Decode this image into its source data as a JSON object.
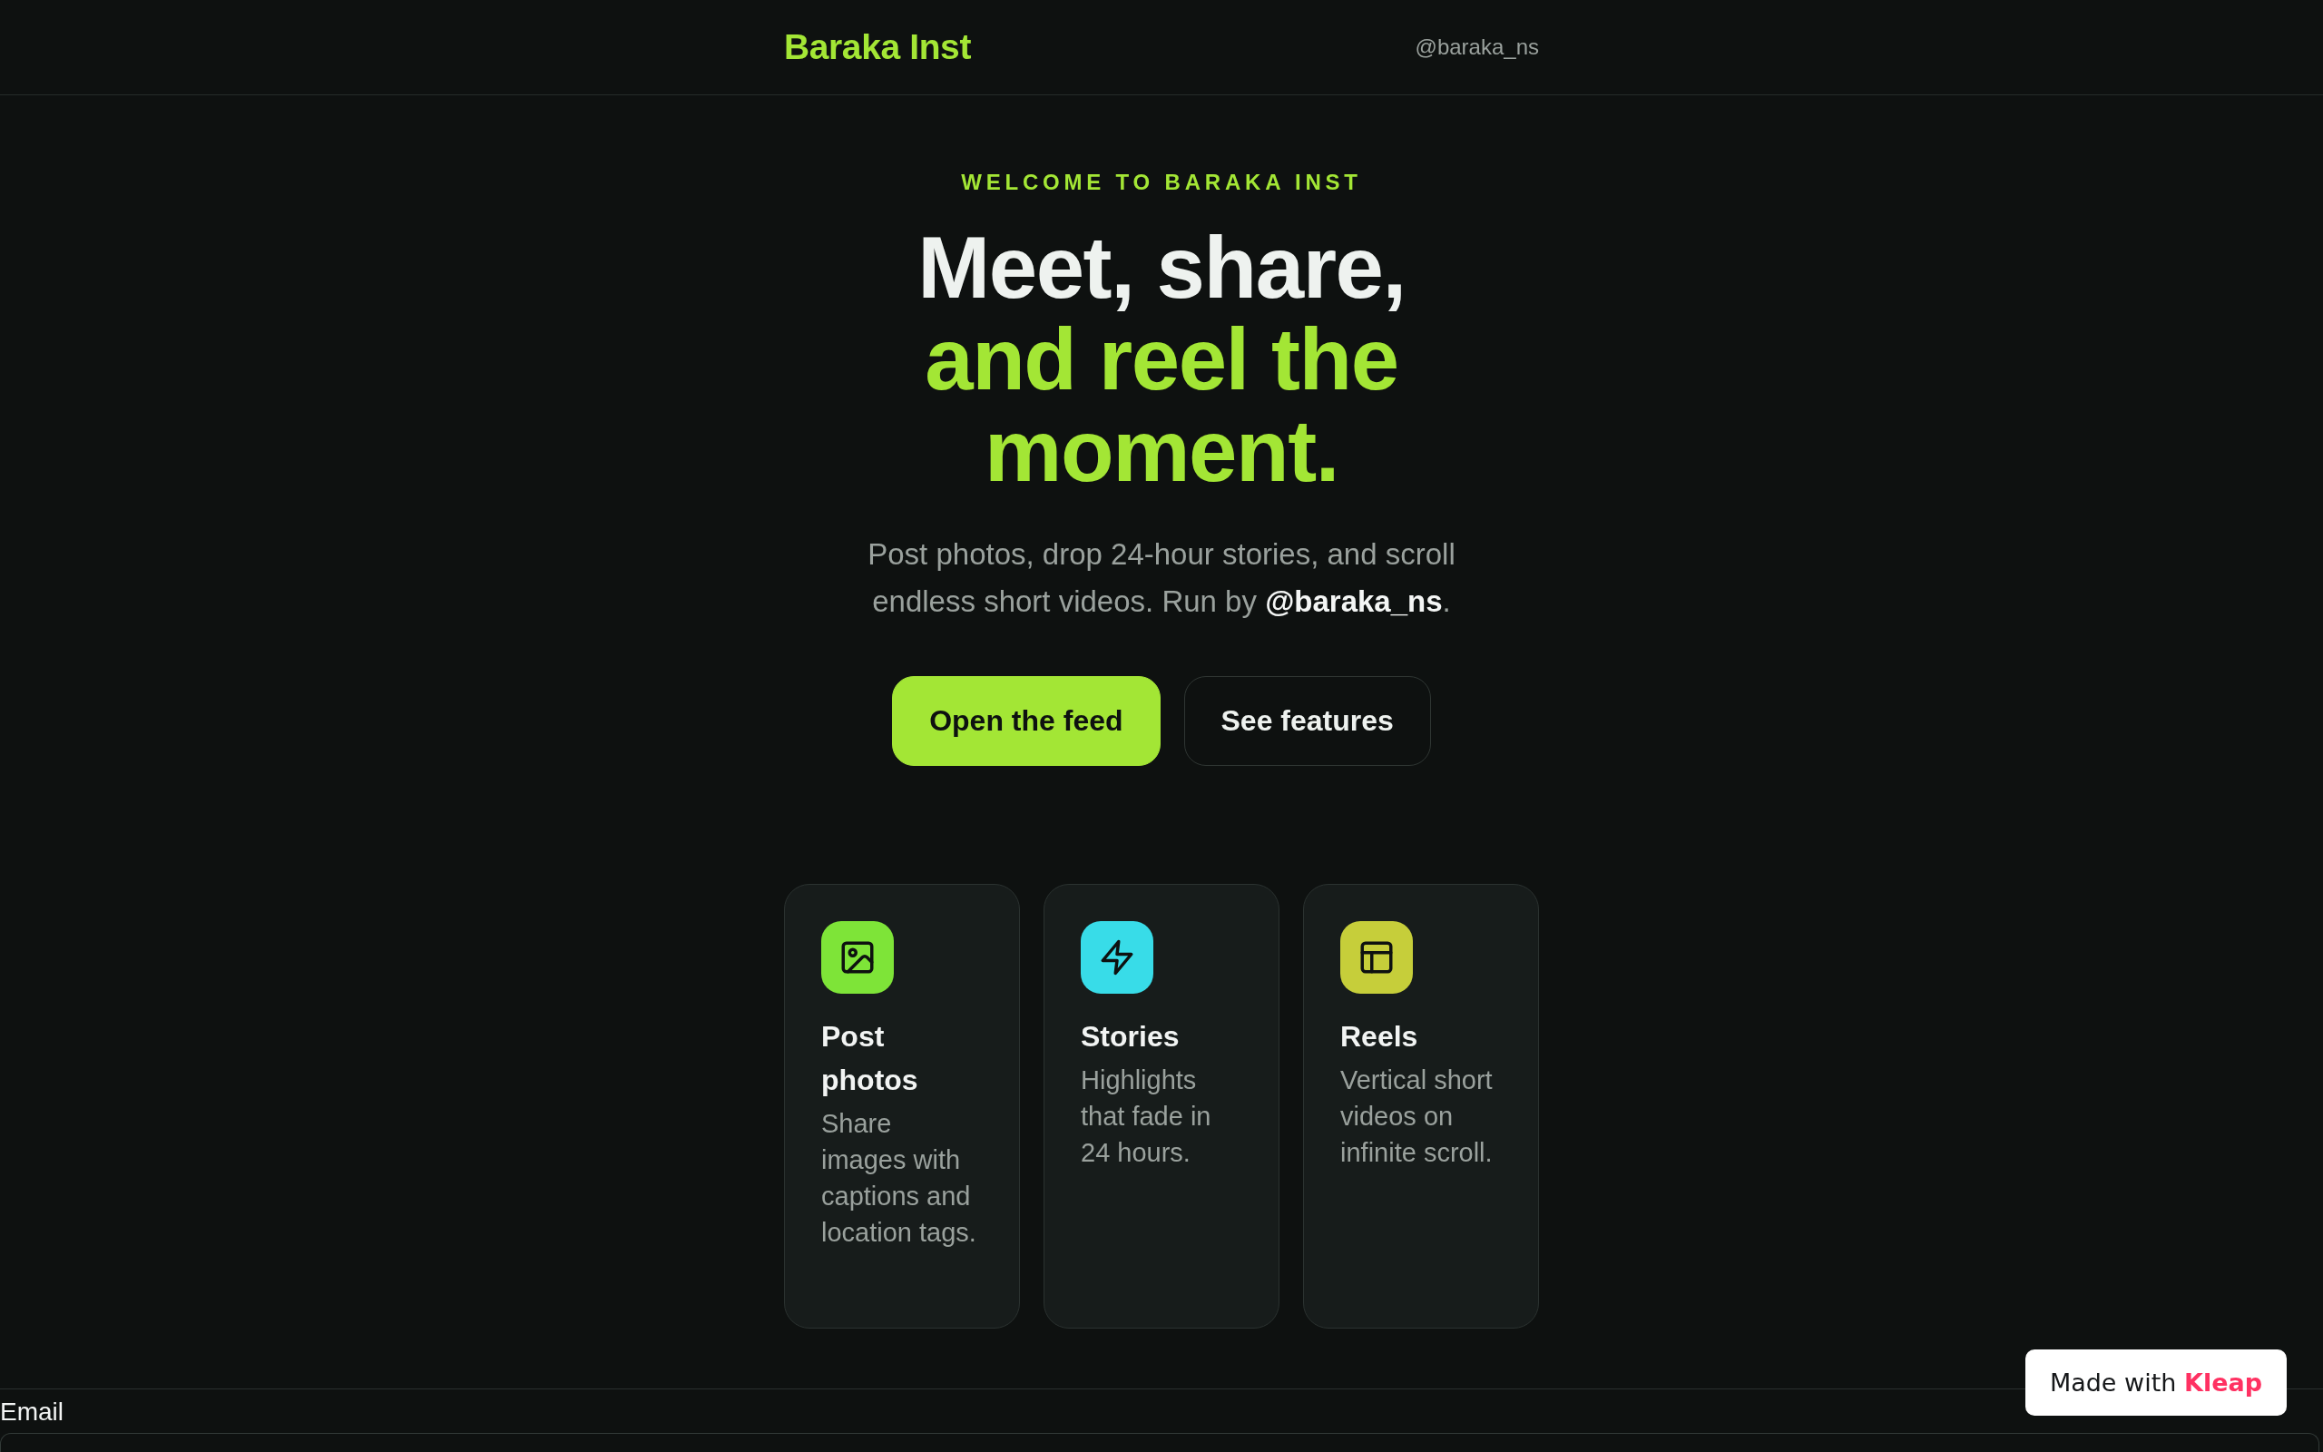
{
  "header": {
    "brand": "Baraka Inst",
    "handle": "@baraka_ns"
  },
  "hero": {
    "eyebrow": "WELCOME TO BARAKA INST",
    "headline": {
      "text": "Meet, share,",
      "highlight": "and reel the moment."
    },
    "subtitle": "Post photos, drop 24-hour stories, and scroll endless short videos. Run by **@baraka_ns**.",
    "buttons": [
      {
        "label": "Open the feed",
        "kind": "primary"
      },
      {
        "label": "See features",
        "kind": "secondary"
      }
    ]
  },
  "features": [
    {
      "kind": "photos",
      "color": "#7ee438",
      "title": "Post photos",
      "description": "Share images with captions and location tags."
    },
    {
      "kind": "stories",
      "color": "#38dce8",
      "title": "Stories",
      "description": "Highlights that fade in 24 hours."
    },
    {
      "kind": "reels",
      "color": "#c6ce3a",
      "title": "Reels",
      "description": "Vertical short videos on infinite scroll."
    }
  ],
  "form": {
    "label": "Email"
  },
  "badge": {
    "text": "Made with",
    "brand": "Kleap"
  }
}
